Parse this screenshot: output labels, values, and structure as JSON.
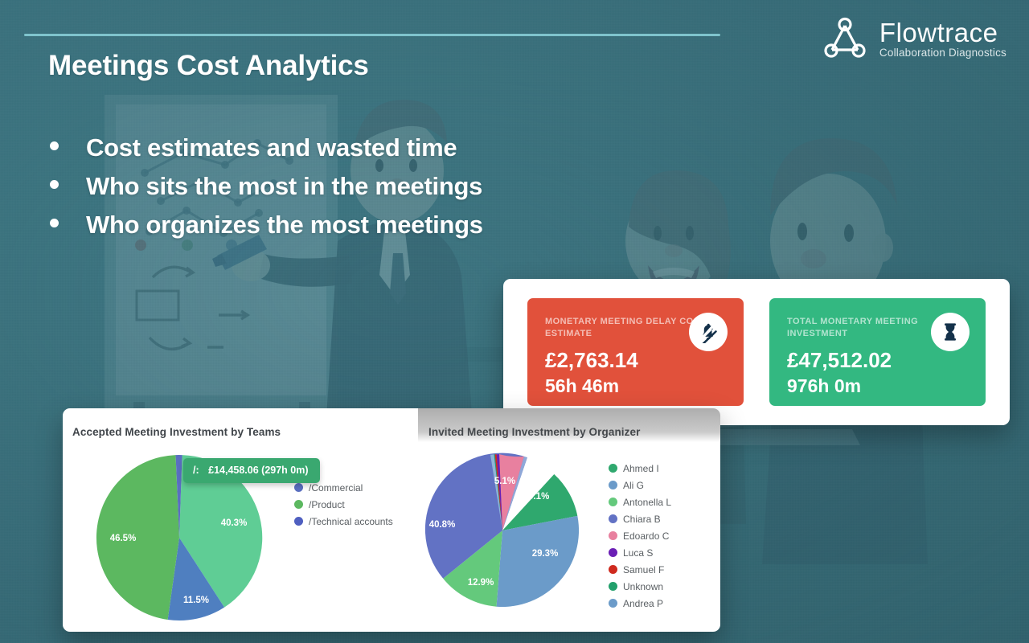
{
  "header": {
    "title": "Meetings Cost Analytics",
    "rule_color": "#7fc4cd"
  },
  "logo": {
    "name": "Flowtrace",
    "tagline": "Collaboration Diagnostics",
    "mark_icon": "three-node-network-icon"
  },
  "bullets": [
    {
      "text": "Cost estimates and wasted time"
    },
    {
      "text": "Who sits the most in the meetings"
    },
    {
      "text": "Who organizes the most meetings"
    }
  ],
  "kpi": {
    "cards": [
      {
        "label": "MONETARY MEETING DELAY COST ESTIMATE",
        "value": "£2,763.14",
        "sub": "56h 46m",
        "color": "#e1513b",
        "icon": "bell-off-icon"
      },
      {
        "label": "TOTAL MONETARY MEETING INVESTMENT",
        "value": "£47,512.02",
        "sub": "976h 0m",
        "color": "#33b881",
        "icon": "hourglass-icon"
      }
    ]
  },
  "charts": {
    "tooltip": {
      "key": "/:",
      "value": "£14,458.06 (297h 0m)",
      "color": "#3aa870"
    }
  },
  "chart_data": [
    {
      "type": "pie",
      "title": "Accepted Meeting Investment by Teams",
      "categories": [
        "/",
        "/Product",
        "/Technical accounts",
        "/Commercial"
      ],
      "values": [
        46.5,
        40.3,
        11.5,
        1.7
      ],
      "labels": [
        "46.5%",
        "40.3%",
        "11.5%",
        ""
      ],
      "colors": [
        "#5cb860",
        "#5fcd95",
        "#4f7fc0",
        "#5a6fc0"
      ],
      "legend": [
        {
          "label": "/Commercial",
          "color": "#5a6fc0"
        },
        {
          "label": "/Product",
          "color": "#5cb860"
        },
        {
          "label": "/Technical accounts",
          "color": "#4f5fc0"
        }
      ],
      "legend_position": "right",
      "annotations": [
        "/: £14,458.06 (297h 0m)"
      ]
    },
    {
      "type": "pie",
      "title": "Invited Meeting Investment by Organizer",
      "categories": [
        "Chiara B",
        "Ali G",
        "Antonella L",
        "Ahmed I",
        "Edoardo C",
        "Andrea P",
        "Luca S",
        "Samuel F",
        "Unknown"
      ],
      "values": [
        40.8,
        29.3,
        12.9,
        10.1,
        5.1,
        0.7,
        0.55,
        0.35,
        0.2
      ],
      "labels": [
        "40.8%",
        "29.3%",
        "12.9%",
        "10.1%",
        "5.1%",
        "",
        "",
        "",
        ""
      ],
      "colors": [
        "#6272c4",
        "#6b9bc9",
        "#64c97c",
        "#2fa86e",
        "#e8809f",
        "#8fa8d8",
        "#6a1fb5",
        "#cf2a1e",
        "#22a06b"
      ],
      "legend": [
        {
          "label": "Ahmed I",
          "color": "#2fa86e"
        },
        {
          "label": "Ali G",
          "color": "#6b9bc9"
        },
        {
          "label": "Antonella L",
          "color": "#64c97c"
        },
        {
          "label": "Chiara B",
          "color": "#6272c4"
        },
        {
          "label": "Edoardo C",
          "color": "#e8809f"
        },
        {
          "label": "Luca S",
          "color": "#6a1fb5"
        },
        {
          "label": "Samuel F",
          "color": "#cf2a1e"
        },
        {
          "label": "Unknown",
          "color": "#22a06b"
        },
        {
          "label": "Andrea P",
          "color": "#6b9bc9"
        }
      ],
      "legend_position": "right"
    }
  ]
}
